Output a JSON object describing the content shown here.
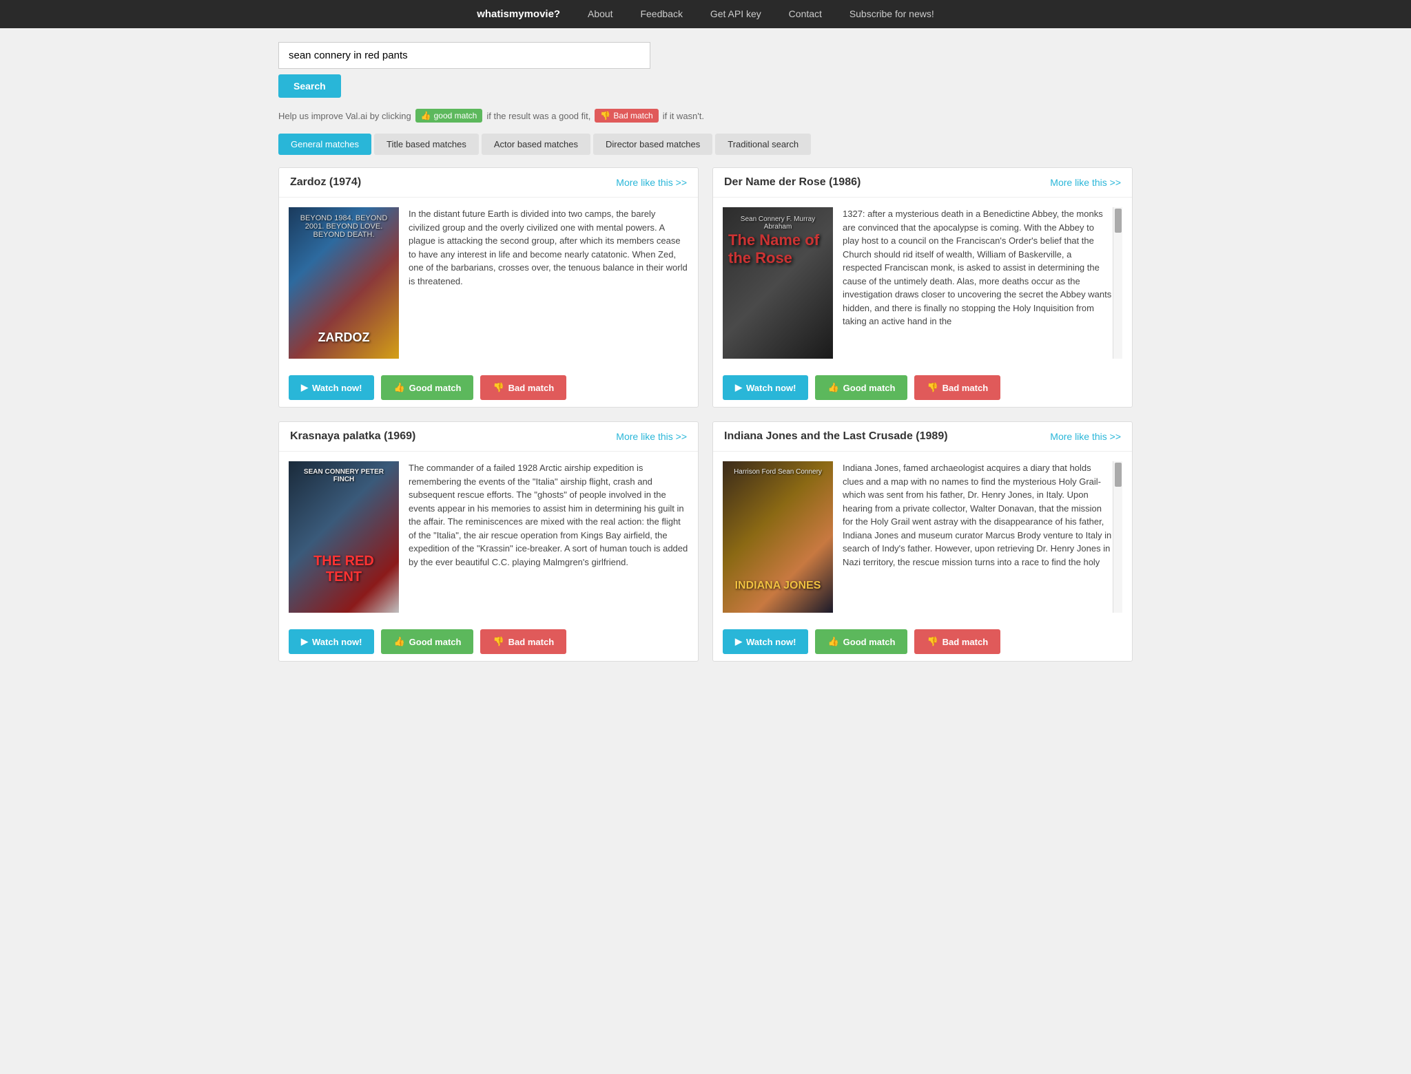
{
  "nav": {
    "brand": "whatismymovie?",
    "links": [
      "About",
      "Feedback",
      "Get API key",
      "Contact",
      "Subscribe for news!"
    ]
  },
  "search": {
    "input_value": "sean connery in red pants",
    "button_label": "Search"
  },
  "improve_text": {
    "prefix": "Help us improve Val.ai by clicking",
    "good_label": "good match",
    "suffix_good": "if the result was a good fit,",
    "bad_label": "Bad match",
    "suffix_bad": "if it wasn't."
  },
  "tabs": [
    {
      "label": "General matches",
      "active": true
    },
    {
      "label": "Title based matches",
      "active": false
    },
    {
      "label": "Actor based matches",
      "active": false
    },
    {
      "label": "Director based matches",
      "active": false
    },
    {
      "label": "Traditional search",
      "active": false
    }
  ],
  "movies": [
    {
      "id": "zardoz",
      "title": "Zardoz (1974)",
      "more_like_this": "More like this >>",
      "description": "In the distant future Earth is divided into two camps, the barely civilized group and the overly civilized one with mental powers. A plague is attacking the second group, after which its members cease to have any interest in life and become nearly catatonic. When Zed, one of the barbarians, crosses over, the tenuous balance in their world is threatened.",
      "poster_title": "ZARDOZ",
      "poster_sub": "BEYOND 1984. BEYOND 2001. BEYOND LOVE. BEYOND DEATH.",
      "watch_label": "Watch now!",
      "good_label": "Good match",
      "bad_label": "Bad match"
    },
    {
      "id": "rose",
      "title": "Der Name der Rose (1986)",
      "more_like_this": "More like this >>",
      "description": "1327: after a mysterious death in a Benedictine Abbey, the monks are convinced that the apocalypse is coming. With the Abbey to play host to a council on the Franciscan's Order's belief that the Church should rid itself of wealth, William of Baskerville, a respected Franciscan monk, is asked to assist in determining the cause of the untimely death. Alas, more deaths occur as the investigation draws closer to uncovering the secret the Abbey wants hidden, and there is finally no stopping the Holy Inquisition from taking an active hand in the",
      "poster_title": "The Name of the Rose",
      "poster_sub": "Sean Connery  F. Murray Abraham",
      "watch_label": "Watch now!",
      "good_label": "Good match",
      "bad_label": "Bad match"
    },
    {
      "id": "krasnaya",
      "title": "Krasnaya palatka (1969)",
      "more_like_this": "More like this >>",
      "description": "The commander of a failed 1928 Arctic airship expedition is remembering the events of the \"Italia\" airship flight, crash and subsequent rescue efforts. The \"ghosts\" of people involved in the events appear in his memories to assist him in determining his guilt in the affair. The reminiscences are mixed with the real action: the flight of the \"Italia\", the air rescue operation from Kings Bay airfield, the expedition of the \"Krassin\" ice-breaker. A sort of human touch is added by the ever beautiful C.C. playing Malmgren's girlfriend.",
      "poster_title": "THE RED TENT",
      "poster_sub": "SEAN CONNERY  PETER FINCH",
      "watch_label": "Watch now!",
      "good_label": "Good match",
      "bad_label": "Bad match"
    },
    {
      "id": "indiana",
      "title": "Indiana Jones and the Last Crusade (1989)",
      "more_like_this": "More like this >>",
      "description": "Indiana Jones, famed archaeologist acquires a diary that holds clues and a map with no names to find the mysterious Holy Grail- which was sent from his father, Dr. Henry Jones, in Italy. Upon hearing from a private collector, Walter Donavan, that the mission for the Holy Grail went astray with the disappearance of his father, Indiana Jones and museum curator Marcus Brody venture to Italy in search of Indy's father. However, upon retrieving Dr. Henry Jones in Nazi territory, the rescue mission turns into a race to find the holy",
      "poster_title": "INDIANA JONES",
      "poster_sub": "Harrison Ford  Sean Connery",
      "watch_label": "Watch now!",
      "good_label": "Good match",
      "bad_label": "Bad match"
    }
  ]
}
